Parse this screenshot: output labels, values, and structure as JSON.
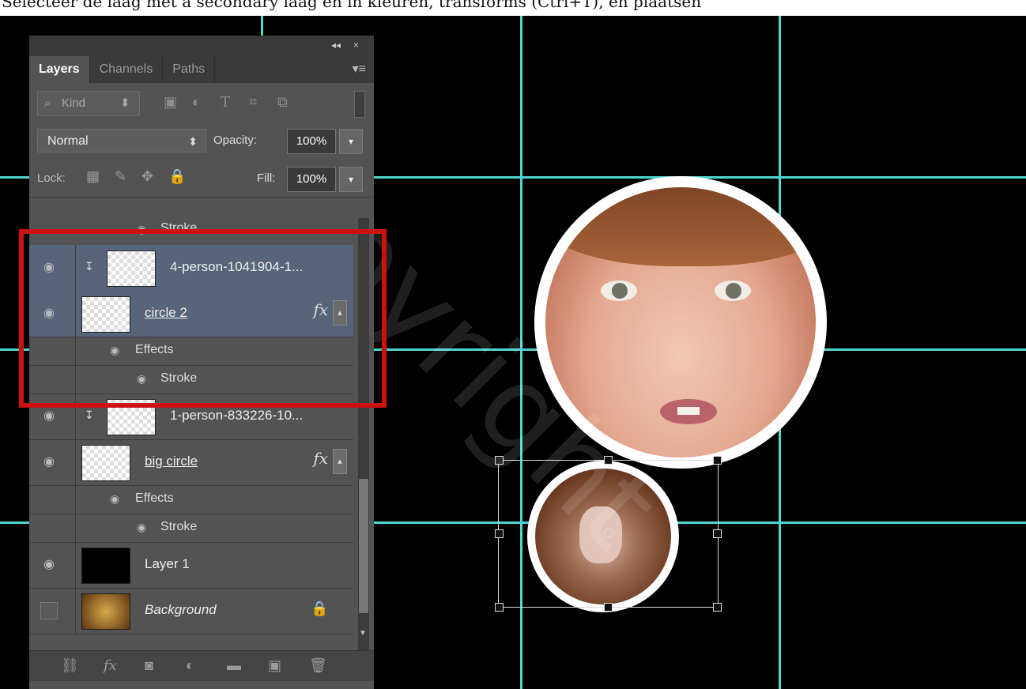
{
  "caption": "Selecteer de laag met a secondary laag en in kleuren, transforms (Ctrl+T), en plaatsen",
  "panel": {
    "controls": {
      "collapse": "◂◂",
      "close": "×"
    },
    "tabs": [
      {
        "label": "Layers",
        "active": true
      },
      {
        "label": "Channels",
        "active": false
      },
      {
        "label": "Paths",
        "active": false
      }
    ],
    "filter": {
      "kind_label": "Kind"
    },
    "blend_mode": "Normal",
    "opacity_label": "Opacity:",
    "opacity_value": "100%",
    "lock_label": "Lock:",
    "fill_label": "Fill:",
    "fill_value": "100%",
    "partial_row_label": "Stroke",
    "layers": [
      {
        "name": "4-person-1041904-1..."
      },
      {
        "name": "circle 2"
      },
      {
        "name": "Effects"
      },
      {
        "name": "Stroke"
      },
      {
        "name": "1-person-833226-10..."
      },
      {
        "name": "big circle"
      },
      {
        "name": "Effects"
      },
      {
        "name": "Stroke"
      },
      {
        "name": "Layer 1"
      },
      {
        "name": "Background"
      }
    ],
    "fx_label": "fx"
  },
  "watermark": "Copyright",
  "icons": [
    "search-icon",
    "image-filter-icon",
    "adjustment-filter-icon",
    "type-filter-icon",
    "shape-filter-icon",
    "smart-object-filter-icon",
    "lock-transparent-icon",
    "lock-paint-icon",
    "lock-move-icon",
    "lock-all-icon",
    "eye-icon",
    "link-icon",
    "fx-icon",
    "mask-icon",
    "adjustment-icon",
    "folder-icon",
    "new-layer-icon",
    "trash-icon"
  ],
  "colors": {
    "guide": "#4fd6d2",
    "highlight": "#cc1111",
    "panel": "#535353",
    "selected": "#58647a"
  }
}
